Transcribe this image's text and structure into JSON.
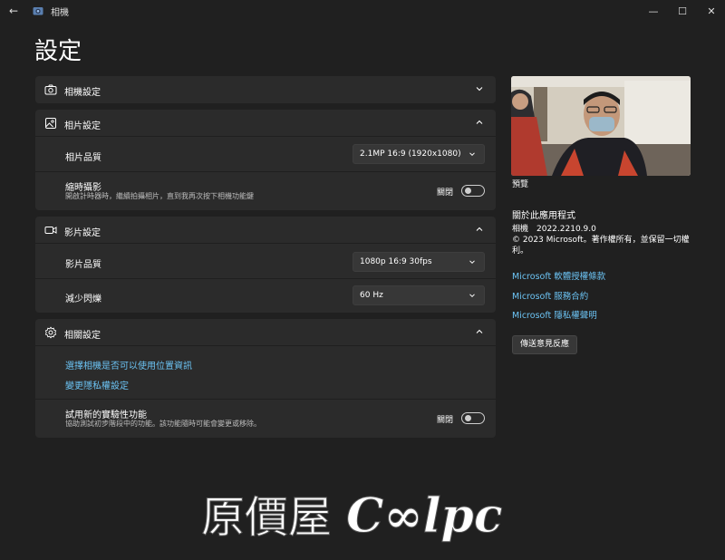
{
  "window": {
    "title": "相機",
    "back": "←",
    "minimize": "—",
    "maximize": "☐",
    "close": "✕"
  },
  "page": {
    "title": "設定"
  },
  "sections": {
    "camera": {
      "title": "相機設定"
    },
    "photo": {
      "title": "相片設定",
      "quality_label": "相片品質",
      "quality_value": "2.1MP 16:9 (1920x1080)",
      "timelapse_label": "縮時攝影",
      "timelapse_desc": "開啟計時器時，繼續拍攝相片，直到我再次按下相機功能鍵",
      "timelapse_state": "關閉"
    },
    "video": {
      "title": "影片設定",
      "quality_label": "影片品質",
      "quality_value": "1080p 16:9 30fps",
      "flicker_label": "減少閃爍",
      "flicker_value": "60 Hz"
    },
    "related": {
      "title": "相關設定",
      "link_location": "選擇相機是否可以使用位置資訊",
      "link_privacy": "變更隱私權設定",
      "experimental_label": "試用新的實驗性功能",
      "experimental_desc": "協助測試初步階段中的功能。該功能隨時可能會變更或移除。",
      "experimental_state": "關閉"
    }
  },
  "side": {
    "preview_label": "預覽",
    "about_title": "關於此應用程式",
    "version": "相機　2022.2210.9.0",
    "copyright": "© 2023 Microsoft。著作權所有，並保留一切權利。",
    "link_license": "Microsoft 軟體授權條款",
    "link_service": "Microsoft 服務合約",
    "link_privacy": "Microsoft 隱私權聲明",
    "feedback": "傳送意見反應"
  },
  "watermark": {
    "text_cjk": "原價屋",
    "text_latin": "C∞lpc"
  }
}
